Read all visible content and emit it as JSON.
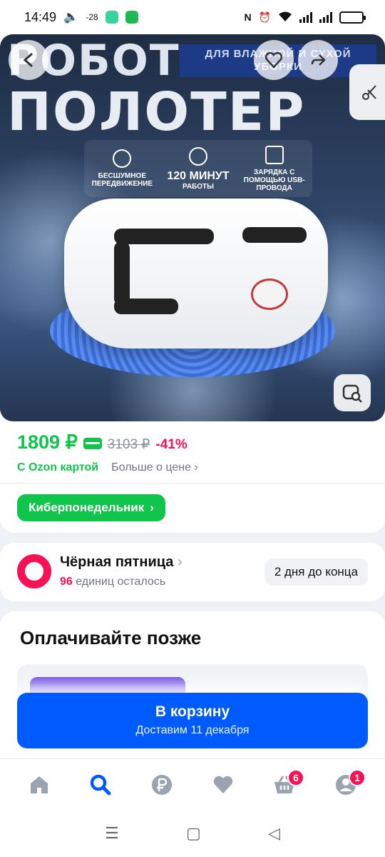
{
  "status_bar": {
    "time": "14:49",
    "temperature": "-28",
    "icons": [
      "volume-icon",
      "message-app-icon",
      "shield-app-icon",
      "nfc-icon",
      "alarm-icon",
      "wifi-icon",
      "signal-icon",
      "battery-icon"
    ]
  },
  "product_image": {
    "headline_1": "РОБОТ",
    "headline_2": "ПОЛОТЕР",
    "tag_text": "ДЛЯ ВЛАЖНОЙ И СУХОЙ УБОРКИ",
    "features": [
      {
        "icon": "moon-icon",
        "big": "",
        "text": "БЕСШУМНОЕ ПЕРЕДВИЖЕНИЕ"
      },
      {
        "icon": "clock-icon",
        "big": "120 МИНУТ",
        "text": "РАБОТЫ"
      },
      {
        "icon": "charging-icon",
        "big": "",
        "text": "ЗАРЯДКА С ПОМОЩЬЮ USB-ПРОВОДА"
      }
    ]
  },
  "price": {
    "current": "1809 ₽",
    "old": "3103 ₽",
    "discount": "-41%",
    "with_card": "С Ozon картой",
    "more": "Больше о цене",
    "promo": "Киберпонедельник"
  },
  "black_friday": {
    "title": "Чёрная пятница",
    "count": "96",
    "remaining_text": "единиц осталось",
    "deadline": "2 дня до конца"
  },
  "pay_later": {
    "title": "Оплачивайте позже"
  },
  "cart": {
    "label": "В корзину",
    "delivery": "Доставим 11 декабря"
  },
  "bottom_nav": {
    "items": [
      {
        "name": "home",
        "badge": ""
      },
      {
        "name": "search",
        "badge": ""
      },
      {
        "name": "ruble",
        "badge": ""
      },
      {
        "name": "favorites",
        "badge": ""
      },
      {
        "name": "cart",
        "badge": "6"
      },
      {
        "name": "profile",
        "badge": "1"
      }
    ],
    "active_color": "#005bff"
  },
  "colors": {
    "green": "#10c44c",
    "pink": "#f91155",
    "blue": "#005bff"
  }
}
